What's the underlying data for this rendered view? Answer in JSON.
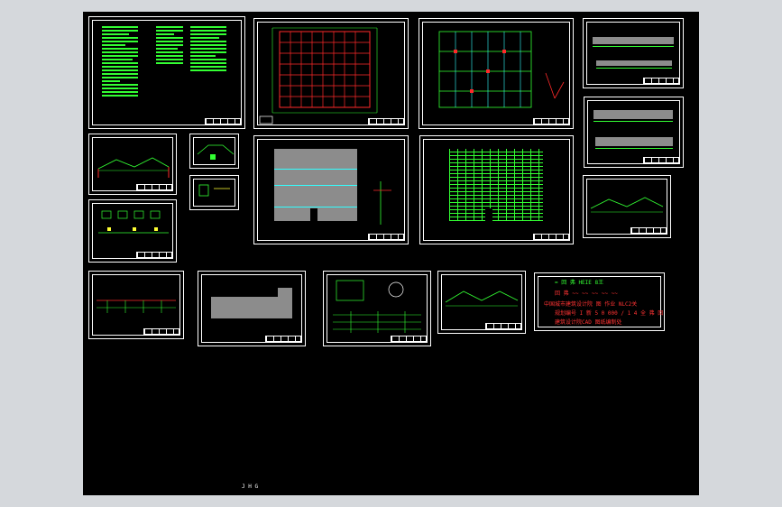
{
  "colors": {
    "background": "#000000",
    "frame": "#ffffff",
    "line_green": "#33ff33",
    "line_red": "#ff2a2a",
    "line_yellow": "#ffff33",
    "line_cyan": "#33ffff",
    "fill_gray": "#8c8c8c"
  },
  "viewport": {
    "bottom_label": "J H G"
  },
  "notes_sheet": {
    "title": "= 回 弗   HEIE 8王",
    "line1": "回 弗   ~~ ~~  ~~ ~~ ~~",
    "line2": "中国城市建筑设计院 图 作业  NLC2关",
    "line3": "规划编号  I 新 5 0 000 / 1 4 全 弗 回",
    "line4": "建筑设计院CAD 图纸编制处"
  }
}
